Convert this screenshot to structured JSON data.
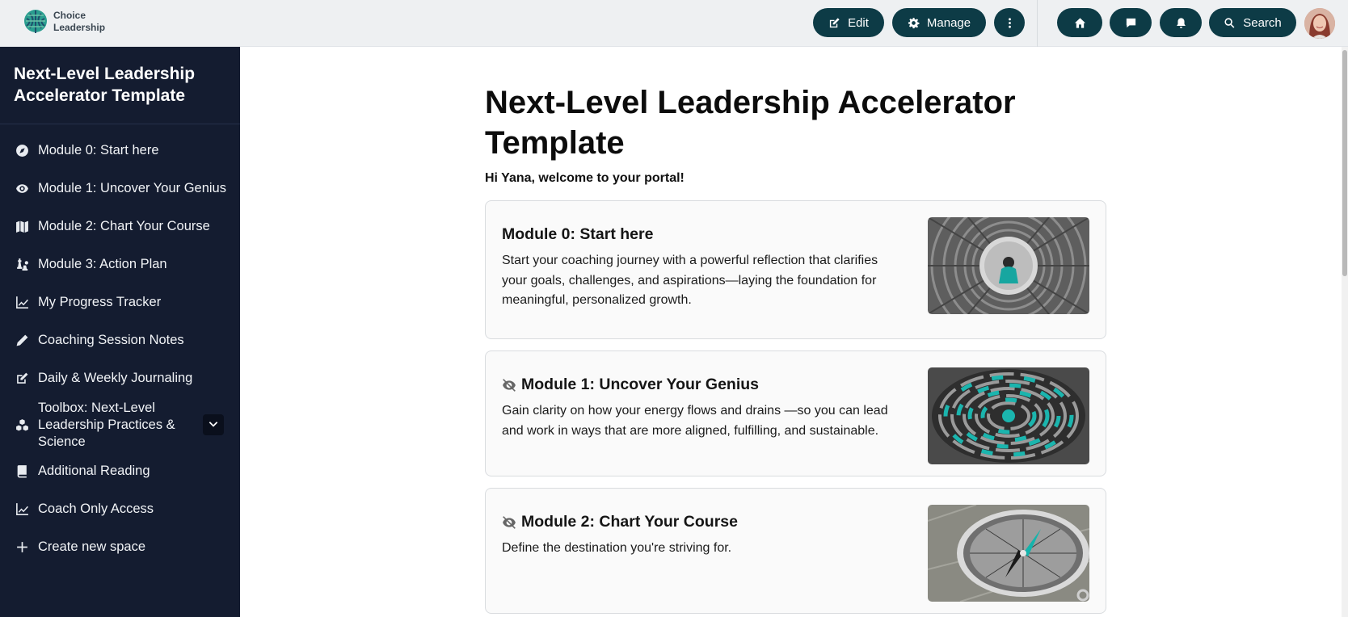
{
  "brand": {
    "line1": "Choice",
    "line2": "Leadership",
    "logo_icon": "tree-logo-icon"
  },
  "topbar": {
    "edit_label": "Edit",
    "manage_label": "Manage",
    "search_label": "Search",
    "icons": [
      "pencil-square-icon",
      "gear-icon",
      "more-vertical-icon",
      "home-icon",
      "chat-icon",
      "bell-icon",
      "search-icon"
    ],
    "accent_color": "#0d3b46"
  },
  "sidebar": {
    "title": "Next-Level Leadership Accelerator Template",
    "background": "#141c30",
    "items": [
      {
        "label": "Module 0: Start here",
        "icon": "compass-icon"
      },
      {
        "label": "Module 1: Uncover Your Genius",
        "icon": "eye-icon"
      },
      {
        "label": "Module 2: Chart Your Course",
        "icon": "map-icon"
      },
      {
        "label": "Module 3: Action Plan",
        "icon": "chess-icon"
      },
      {
        "label": "My Progress Tracker",
        "icon": "line-chart-icon"
      },
      {
        "label": "Coaching Session Notes",
        "icon": "pencil-icon"
      },
      {
        "label": "Daily & Weekly Journaling",
        "icon": "edit-icon"
      },
      {
        "label": "Toolbox: Next-Level Leadership Practices & Science",
        "icon": "cubes-icon",
        "expandable": true
      },
      {
        "label": "Additional Reading",
        "icon": "book-icon"
      },
      {
        "label": "Coach Only Access",
        "icon": "line-chart-icon"
      },
      {
        "label": "Create new space",
        "icon": "plus-icon"
      }
    ]
  },
  "main": {
    "title": "Next-Level Leadership Accelerator Template",
    "welcome": "Hi Yana, welcome to your portal!",
    "cards": [
      {
        "title": "Module 0: Start here",
        "hidden": false,
        "description": "Start your coaching journey with a powerful reflection that clarifies your goals, challenges, and aspirations—laying the foundation for meaningful, personalized growth.",
        "image": "spiral-staircase-image"
      },
      {
        "title": "Module 1: Uncover Your Genius",
        "hidden": true,
        "description": "Gain clarity on how your energy flows and drains —so you can lead and work in ways that are more aligned, fulfilling, and sustainable.",
        "image": "circular-maze-image"
      },
      {
        "title": "Module 2: Chart Your Course",
        "hidden": true,
        "description": "Define the destination you're striving for.",
        "image": "compass-image"
      }
    ]
  }
}
